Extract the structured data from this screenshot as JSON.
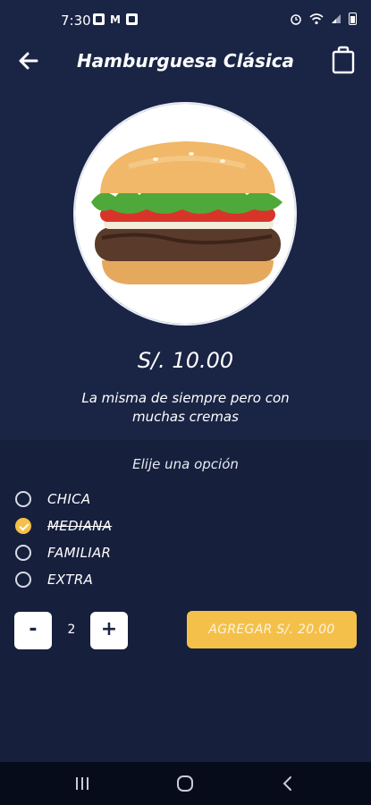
{
  "status_bar": {
    "time": "7:30"
  },
  "header": {
    "title": "Hamburguesa Clásica"
  },
  "product": {
    "price": "S/. 10.00",
    "description": "La misma de siempre pero con muchas cremas"
  },
  "options": {
    "heading": "Elije una opción",
    "items": [
      {
        "label": "CHICA",
        "selected": false
      },
      {
        "label": "MEDIANA",
        "selected": true
      },
      {
        "label": "FAMILIAR",
        "selected": false
      },
      {
        "label": "EXTRA",
        "selected": false
      }
    ]
  },
  "quantity": {
    "minus": "-",
    "value": "2",
    "plus": "+"
  },
  "add_button": {
    "label": "AGREGAR S/. 20.00"
  },
  "colors": {
    "background": "#1a2545",
    "panel": "#16203d",
    "accent": "#f5c04a"
  }
}
